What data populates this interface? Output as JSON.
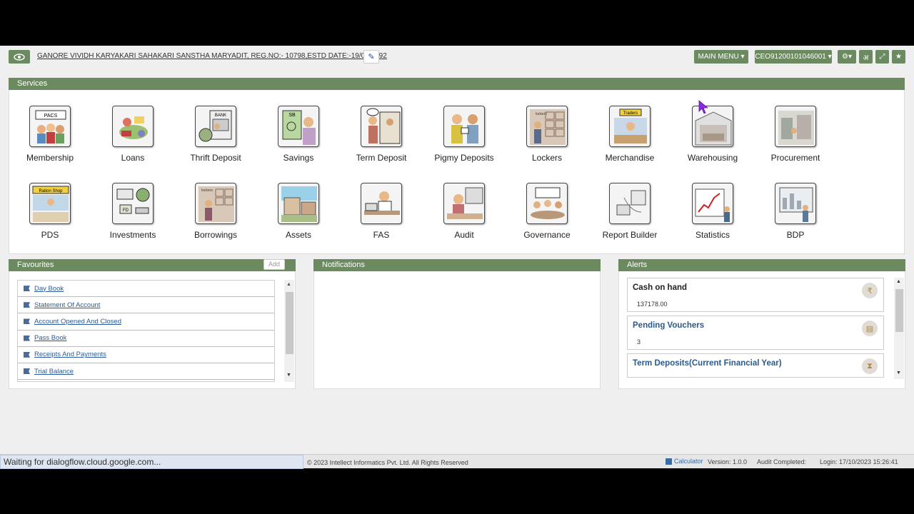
{
  "header": {
    "org_title": "GANORE VIVIDH KARYAKARI SAHAKARI SANSTHA MARYADIT, REG.NO:- 10798,ESTD DATE:-19/09/1992",
    "main_menu_label": "MAIN MENU ▾",
    "user_label": "CEO91200101046001 ▾",
    "lang_label": "अ"
  },
  "services": {
    "title": "Services",
    "row1": [
      "Membership",
      "Loans",
      "Thrift Deposit",
      "Savings",
      "Term Deposit",
      "Pigmy Deposits",
      "Lockers",
      "Merchandise",
      "Warehousing",
      "Procurement"
    ],
    "row2": [
      "PDS",
      "Investments",
      "Borrowings",
      "Assets",
      "FAS",
      "Audit",
      "Governance",
      "Report Builder",
      "Statistics",
      "BDP"
    ],
    "icon_texts": {
      "membership": "PACS",
      "thrift": "BANK",
      "savings": "SB",
      "lockers": "lockers",
      "merchandise": "Traders",
      "pds": "Ration Shop",
      "investments": "FD",
      "borrowings": "lockers"
    }
  },
  "favourites": {
    "title": "Favourites",
    "add_label": "Add",
    "items": [
      "Day Book",
      "Statement Of Account",
      "Account Opened And Closed",
      "Pass Book",
      "Receipts And Payments",
      "Trial Balance"
    ]
  },
  "notifications": {
    "title": "Notifications"
  },
  "alerts": {
    "title": "Alerts",
    "cards": [
      {
        "title": "Cash on hand",
        "value": "137178.00",
        "icon": "₹",
        "title_color": "#222222"
      },
      {
        "title": "Pending Vouchers",
        "value": "3",
        "icon": "▤",
        "title_color": "#2a5a8a"
      },
      {
        "title": "Term Deposits(Current Financial Year)",
        "value": "",
        "icon": "⧗",
        "title_color": "#2a5a8a"
      }
    ]
  },
  "status": {
    "loading": "Waiting for dialogflow.cloud.google.com...",
    "copyright": "© 2023 Intellect Informatics Pvt. Ltd. All Rights Reserved",
    "calculator": "Calculator",
    "version": "Version: 1.0.0",
    "audit": "Audit Completed:",
    "login": "Login: 17/10/2023 15:26:41"
  },
  "colors": {
    "accent": "#6b8a5f",
    "link": "#2a5a9a"
  }
}
